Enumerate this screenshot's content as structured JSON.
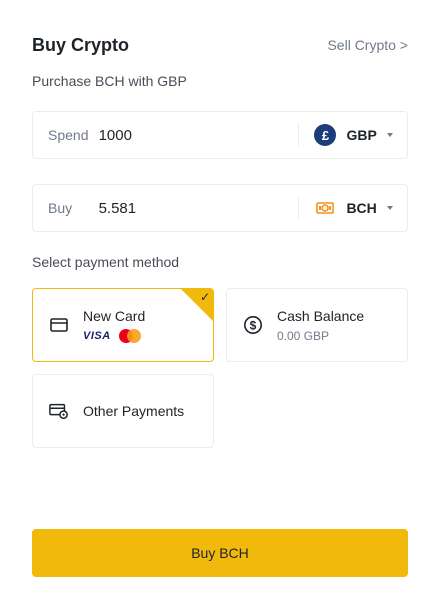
{
  "header": {
    "title": "Buy Crypto",
    "sell_link": "Sell Crypto >"
  },
  "subtitle": "Purchase BCH with GBP",
  "spend": {
    "label": "Spend",
    "value": "1000",
    "currency": "GBP",
    "currency_icon": "pound-sign-icon",
    "currency_symbol": "£"
  },
  "buy": {
    "label": "Buy",
    "value": "5.581",
    "currency": "BCH",
    "currency_icon": "bch-coin-icon"
  },
  "payment": {
    "label": "Select payment method",
    "methods": [
      {
        "name": "New Card",
        "icon": "credit-card-icon",
        "brands": [
          "VISA",
          "mastercard"
        ],
        "selected": true
      },
      {
        "name": "Cash Balance",
        "sub": "0.00 GBP",
        "icon": "dollar-circle-icon",
        "selected": false
      },
      {
        "name": "Other Payments",
        "icon": "card-settings-icon",
        "selected": false
      }
    ]
  },
  "buy_button": "Buy BCH",
  "colors": {
    "accent": "#f0b90b",
    "text": "#1e2329",
    "muted": "#707a8a",
    "border": "#eaecef",
    "gbp_badge": "#1d3c7a",
    "bch_orange": "#f7931a"
  }
}
